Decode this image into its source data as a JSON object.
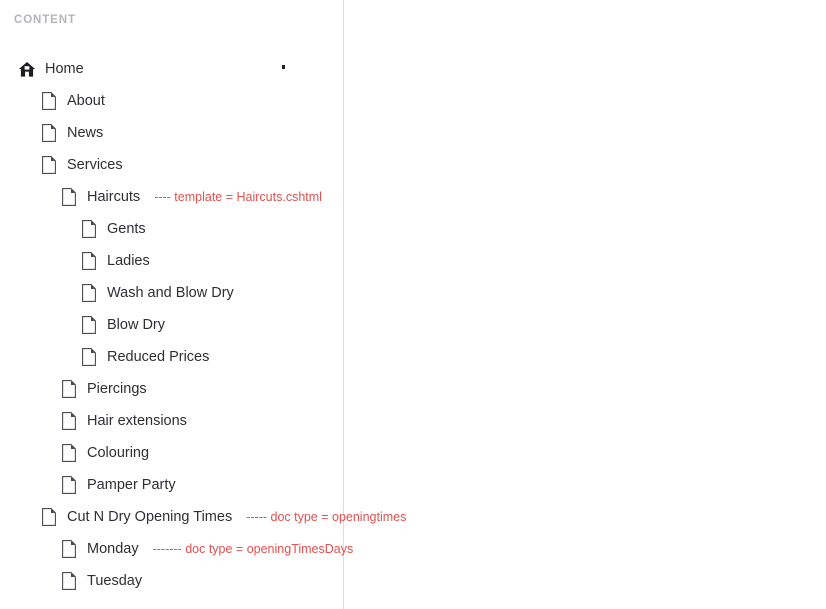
{
  "panel": {
    "section_header": "CONTENT",
    "divider_color": "#dcdcdf",
    "note_color": "#e0514f",
    "label_color": "#2f2f33",
    "header_color": "#b5b5bb"
  },
  "tree": {
    "items": [
      {
        "label": "Home",
        "icon": "home-icon",
        "level": 0,
        "note": ""
      },
      {
        "label": "About",
        "icon": "document-icon",
        "level": 1,
        "note": ""
      },
      {
        "label": "News",
        "icon": "document-icon",
        "level": 1,
        "note": ""
      },
      {
        "label": "Services",
        "icon": "document-icon",
        "level": 1,
        "note": ""
      },
      {
        "label": "Haircuts",
        "icon": "document-icon",
        "level": 2,
        "note": "---- template = Haircuts.cshtml"
      },
      {
        "label": "Gents",
        "icon": "document-icon",
        "level": 3,
        "note": ""
      },
      {
        "label": "Ladies",
        "icon": "document-icon",
        "level": 3,
        "note": ""
      },
      {
        "label": "Wash and Blow Dry",
        "icon": "document-icon",
        "level": 3,
        "note": ""
      },
      {
        "label": "Blow Dry",
        "icon": "document-icon",
        "level": 3,
        "note": ""
      },
      {
        "label": "Reduced Prices",
        "icon": "document-icon",
        "level": 3,
        "note": ""
      },
      {
        "label": "Piercings",
        "icon": "document-icon",
        "level": 2,
        "note": ""
      },
      {
        "label": "Hair extensions",
        "icon": "document-icon",
        "level": 2,
        "note": ""
      },
      {
        "label": "Colouring",
        "icon": "document-icon",
        "level": 2,
        "note": ""
      },
      {
        "label": "Pamper Party",
        "icon": "document-icon",
        "level": 2,
        "note": ""
      },
      {
        "label": "Cut N Dry Opening Times",
        "icon": "document-icon",
        "level": 1,
        "note": "----- doc type = openingtimes"
      },
      {
        "label": "Monday",
        "icon": "document-icon",
        "level": 2,
        "note": "------- doc type = openingTimesDays"
      },
      {
        "label": "Tuesday",
        "icon": "document-icon",
        "level": 2,
        "note": ""
      }
    ]
  }
}
